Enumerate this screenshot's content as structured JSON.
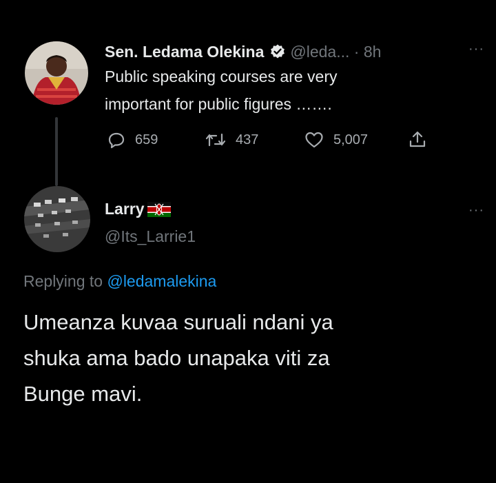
{
  "original_tweet": {
    "author_name": "Sen. Ledama Olekina",
    "handle_time": "@leda... · 8h",
    "text_line1": "Public speaking courses are very",
    "text_line2": "important for public figures …….",
    "replies": "659",
    "retweets": "437",
    "likes": "5,007",
    "more": "···"
  },
  "reply_tweet": {
    "author_name": "Larry",
    "handle": "@Its_Larrie1",
    "more": "···",
    "replying_prefix": "Replying to",
    "replying_handle": "@ledamalekina",
    "text_line1": "Umeanza kuvaa suruali ndani ya",
    "text_line2": "shuka ama bado unapaka viti za",
    "text_line3": "Bunge mavi."
  },
  "colors": {
    "background": "#000000",
    "text": "#e7e9ea",
    "muted": "#71767b",
    "link": "#1d9bf0",
    "verified": "#e7e9ea"
  }
}
